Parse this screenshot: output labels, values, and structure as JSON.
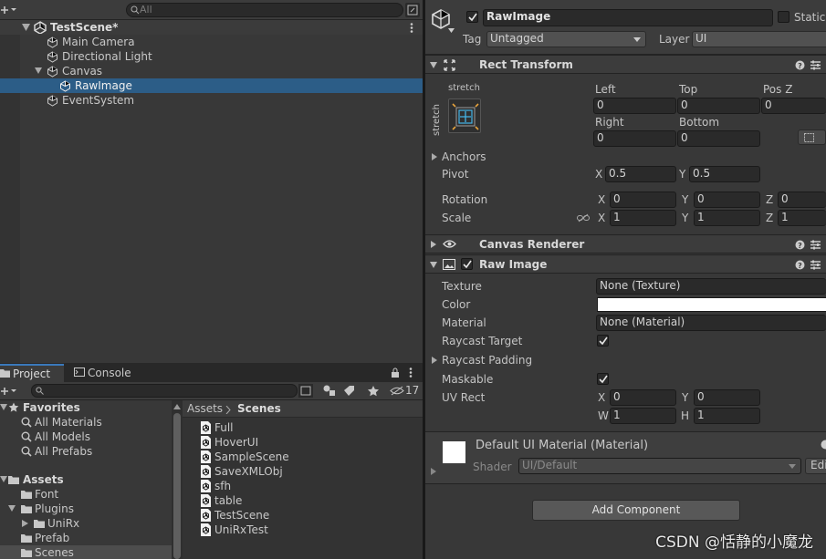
{
  "hierarchy": {
    "search_placeholder": "All",
    "scene": "TestScene*",
    "items": [
      "Main Camera",
      "Directional Light",
      "Canvas",
      "RawImage",
      "EventSystem"
    ]
  },
  "project": {
    "tabs": [
      "Project",
      "Console"
    ],
    "hidden_count": "17",
    "favorites_label": "Favorites",
    "favorites": [
      "All Materials",
      "All Models",
      "All Prefabs"
    ],
    "assets_label": "Assets",
    "folders": [
      "Font",
      "Plugins",
      "UniRx",
      "Prefab",
      "Scenes"
    ],
    "breadcrumb": [
      "Assets",
      "Scenes"
    ],
    "files": [
      "Full",
      "HoverUI",
      "SampleScene",
      "SaveXMLObj",
      "sfh",
      "table",
      "TestScene",
      "UniRxTest"
    ]
  },
  "inspector": {
    "object_name": "RawImage",
    "static_label": "Static",
    "tag_label": "Tag",
    "tag_value": "Untagged",
    "layer_label": "Layer",
    "layer_value": "UI",
    "rect_transform": {
      "title": "Rect Transform",
      "anchor_h": "stretch",
      "anchor_v": "stretch",
      "left_label": "Left",
      "left": "0",
      "top_label": "Top",
      "top": "0",
      "posz_label": "Pos Z",
      "posz": "0",
      "right_label": "Right",
      "right": "0",
      "bottom_label": "Bottom",
      "bottom": "0",
      "anchors_label": "Anchors",
      "pivot_label": "Pivot",
      "pivot_x": "0.5",
      "pivot_y": "0.5",
      "rotation_label": "Rotation",
      "rot_x": "0",
      "rot_y": "0",
      "rot_z": "0",
      "scale_label": "Scale",
      "scale_x": "1",
      "scale_y": "1",
      "scale_z": "1",
      "x": "X",
      "y": "Y",
      "z": "Z"
    },
    "canvas_renderer": {
      "title": "Canvas Renderer"
    },
    "raw_image": {
      "title": "Raw Image",
      "texture_label": "Texture",
      "texture_value": "None (Texture)",
      "color_label": "Color",
      "color_value": "#ffffff",
      "material_label": "Material",
      "material_value": "None (Material)",
      "raycast_target_label": "Raycast Target",
      "raycast_padding_label": "Raycast Padding",
      "maskable_label": "Maskable",
      "uvrect_label": "UV Rect",
      "uv_x": "0",
      "uv_y": "0",
      "uv_w": "1",
      "uv_h": "1",
      "w": "W",
      "h": "H"
    },
    "material_preview": {
      "name": "Default UI Material (Material)",
      "shader_label": "Shader",
      "shader_value": "UI/Default",
      "edit_label": "Edi"
    },
    "add_component": "Add Component"
  },
  "watermark": "CSDN @恬静的小魔龙",
  "colors": {
    "selection": "#2c5d87",
    "panel": "#383838",
    "header": "#3c3c3c"
  }
}
